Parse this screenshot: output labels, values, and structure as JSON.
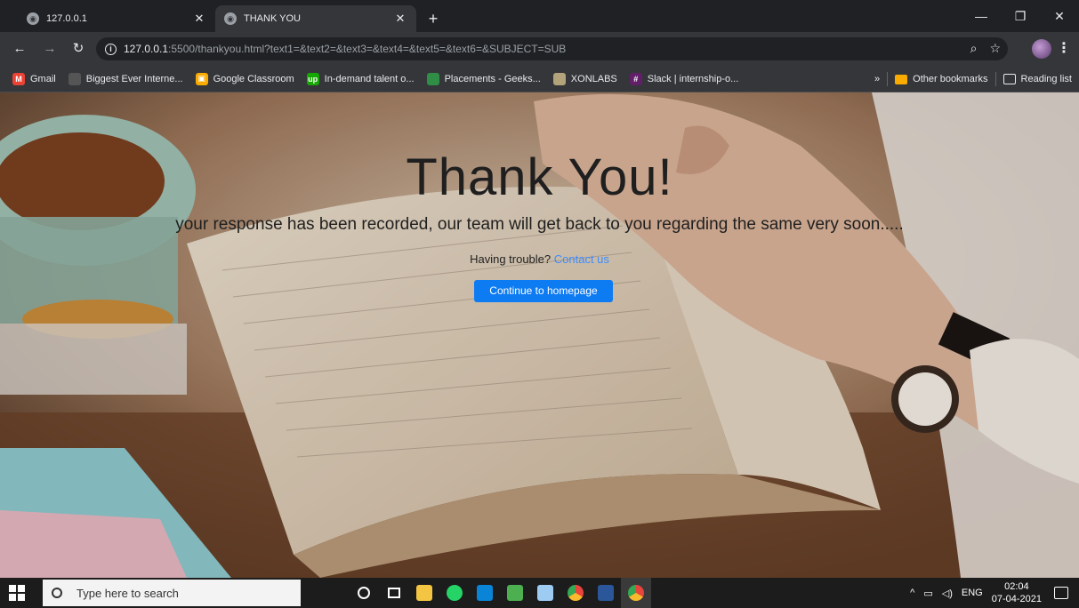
{
  "browser": {
    "tabs": [
      {
        "title": "127.0.0.1",
        "active": false
      },
      {
        "title": "THANK YOU",
        "active": true
      }
    ],
    "new_tab": "+",
    "url_host": "127.0.0.1",
    "url_rest": ":5500/thankyou.html?text1=&text2=&text3=&text4=&text5=&text6=&SUBJECT=SUB",
    "bookmarks": [
      {
        "label": "Gmail",
        "color": "#ea4335",
        "glyph": "M"
      },
      {
        "label": "Biggest Ever Interne...",
        "color": "#555555",
        "glyph": ""
      },
      {
        "label": "Google Classroom",
        "color": "#f9ab00",
        "glyph": "▣"
      },
      {
        "label": "In-demand talent o...",
        "color": "#14a800",
        "glyph": "up"
      },
      {
        "label": "Placements - Geeks...",
        "color": "#2f8d46",
        "glyph": ""
      },
      {
        "label": "XONLABS",
        "color": "#b3a37a",
        "glyph": ""
      },
      {
        "label": "Slack | internship-o...",
        "color": "#611f69",
        "glyph": "#"
      }
    ],
    "bookmarks_overflow": "»",
    "other_bookmarks": "Other bookmarks",
    "reading_list": "Reading list"
  },
  "page": {
    "title": "Thank You!",
    "message": "your response has been recorded, our team will get back to you regarding the same very soon.....",
    "trouble_prefix": "Having trouble?",
    "contact_link": "Contact us",
    "home_button": "Continue to homepage"
  },
  "taskbar": {
    "search_placeholder": "Type here to search",
    "language": "ENG",
    "time": "02:04",
    "date": "07-04-2021",
    "apps": [
      {
        "name": "cortana",
        "color": "transparent"
      },
      {
        "name": "task-view",
        "color": "transparent"
      },
      {
        "name": "file-explorer",
        "color": "#f4c542"
      },
      {
        "name": "whatsapp",
        "color": "#25d366"
      },
      {
        "name": "vscode",
        "color": "#0a84d6"
      },
      {
        "name": "excel-like",
        "color": "#4caf50"
      },
      {
        "name": "virtualbox",
        "color": "#9ecbf2"
      },
      {
        "name": "chrome",
        "color": "#e8453c"
      },
      {
        "name": "word",
        "color": "#2b579a"
      },
      {
        "name": "chrome-profile",
        "color": "#e8453c"
      }
    ]
  }
}
